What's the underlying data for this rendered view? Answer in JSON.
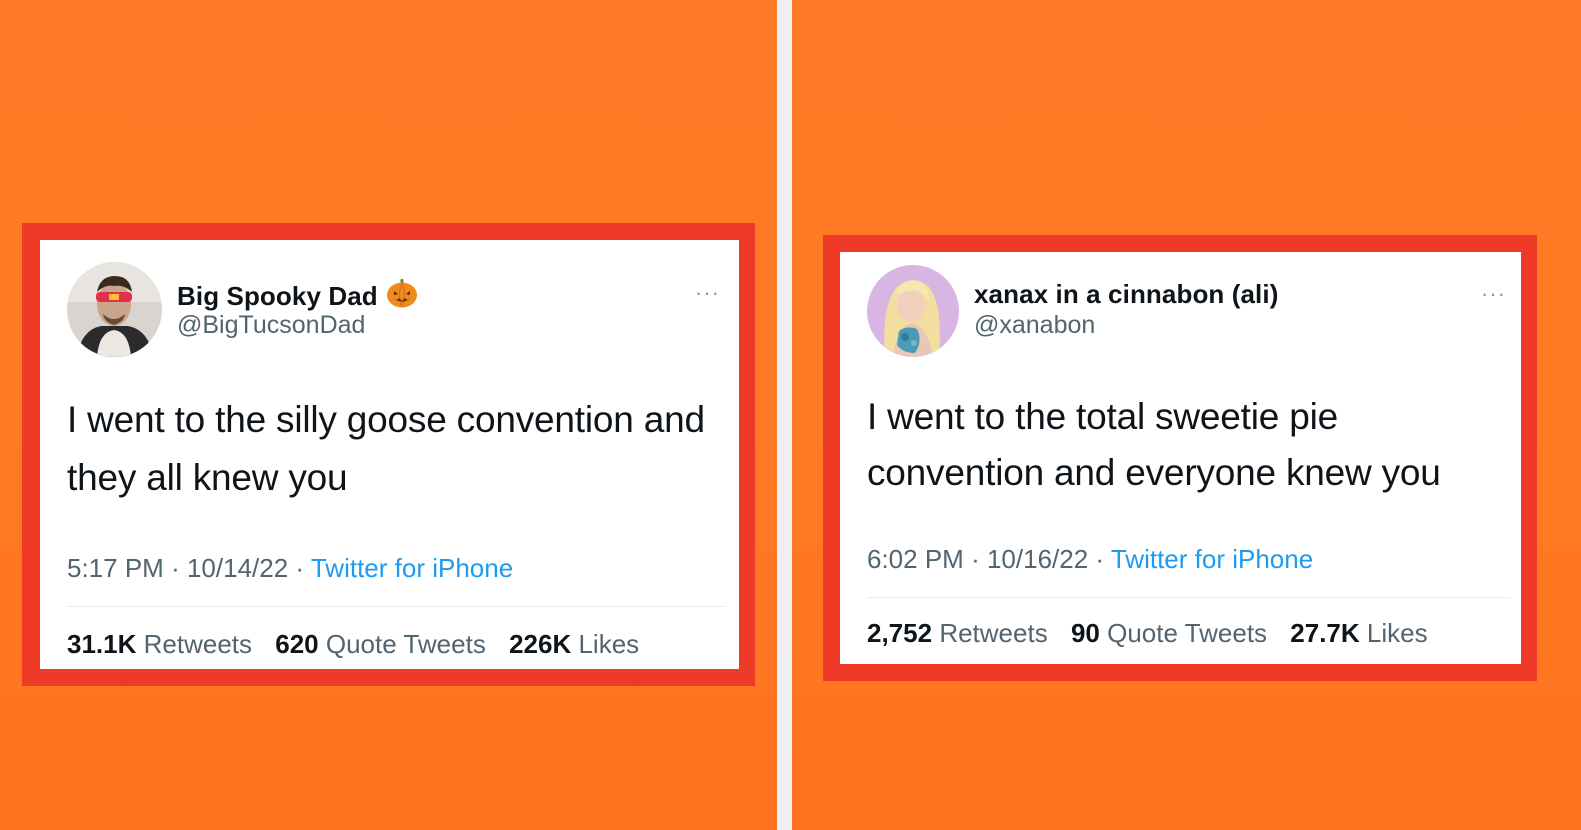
{
  "background_color": "#ff7a24",
  "frame_color": "#ee3a27",
  "link_color": "#1d9bf0",
  "tweets": [
    {
      "display_name": "Big Spooky Dad",
      "name_emoji": "jack-o-lantern-icon",
      "handle": "@BigTucsonDad",
      "more": "···",
      "text": "I went to the silly goose convention and they all knew you",
      "time": "5:17 PM",
      "sep1": "·",
      "date": "10/14/22",
      "sep2": "·",
      "source": "Twitter for iPhone",
      "retweets_count": "31.1K",
      "retweets_label": "Retweets",
      "quotes_count": "620",
      "quotes_label": "Quote Tweets",
      "likes_count": "226K",
      "likes_label": "Likes"
    },
    {
      "display_name": "xanax in a cinnabon (ali)",
      "handle": "@xanabon",
      "more": "···",
      "text": "I went to the total sweetie pie convention and everyone knew you",
      "time": "6:02 PM",
      "sep1": "·",
      "date": "10/16/22",
      "sep2": "·",
      "source": "Twitter for iPhone",
      "retweets_count": "2,752",
      "retweets_label": "Retweets",
      "quotes_count": "90",
      "quotes_label": "Quote Tweets",
      "likes_count": "27.7K",
      "likes_label": "Likes"
    }
  ]
}
